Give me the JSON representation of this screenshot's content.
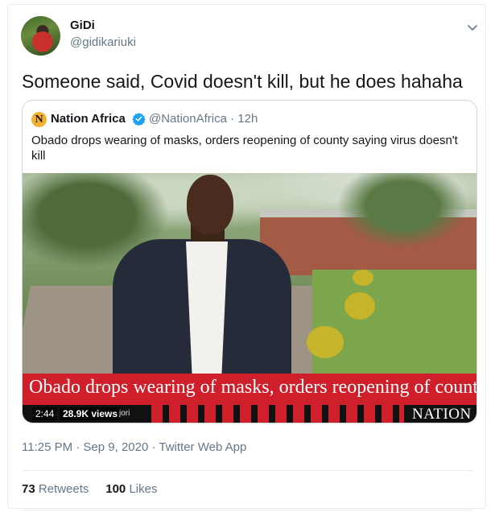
{
  "tweet": {
    "author_name": "GiDi",
    "author_handle": "@gidikariuki",
    "text": "Someone said, Covid doesn't kill, but he does hahaha",
    "meta": "11:25 PM · Sep 9, 2020 · Twitter Web App",
    "retweets_count": "73",
    "retweets_label": "Retweets",
    "likes_count": "100",
    "likes_label": "Likes",
    "icons": {
      "more": "chevron-down-icon"
    }
  },
  "quoted": {
    "logo_letter": "N",
    "author_name": "Nation Africa",
    "author_handle": "@NationAfrica · 12h",
    "text": "Obado drops wearing of masks, orders reopening of county saying virus doesn't kill",
    "icons": {
      "verified": "verified-badge-icon"
    },
    "video": {
      "banner_text": "Obado drops wearing of masks, orders reopening of county",
      "duration": "2:44",
      "views": "28.9K views",
      "ticker_fragment": "jori",
      "brand": "NATION"
    }
  },
  "colors": {
    "text": "#14171a",
    "secondary": "#657786",
    "border": "#e6ecf0",
    "verified": "#1da1f2",
    "nation_red": "#cf1f2b",
    "nation_logo": "#f2b132"
  }
}
